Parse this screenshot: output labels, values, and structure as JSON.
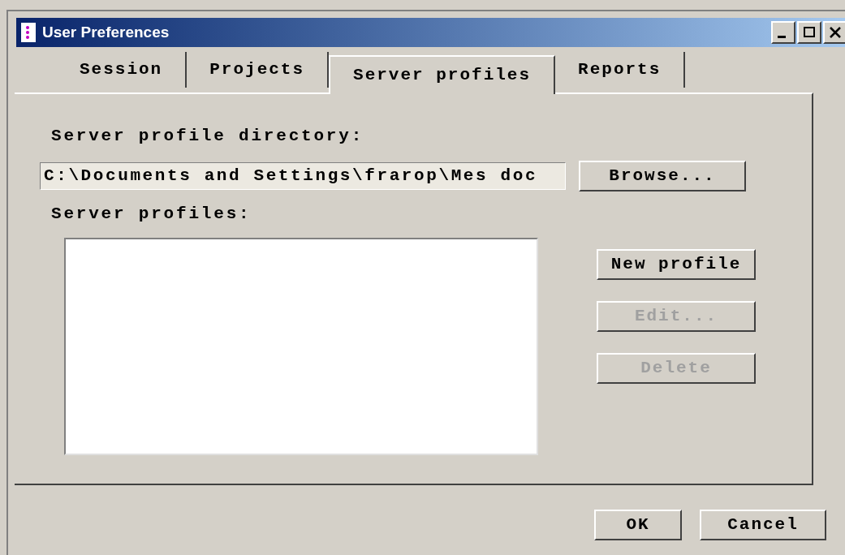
{
  "window": {
    "title": "User Preferences"
  },
  "tabs": [
    {
      "label": "Session",
      "selected": false
    },
    {
      "label": "Projects",
      "selected": false
    },
    {
      "label": "Server profiles",
      "selected": true
    },
    {
      "label": "Reports",
      "selected": false
    }
  ],
  "directory": {
    "label": "Server profile directory:",
    "value": "C:\\Documents and Settings\\frarop\\Mes doc",
    "browse": "Browse..."
  },
  "profiles": {
    "label": "Server profiles:",
    "buttons": [
      {
        "label": "New profile",
        "disabled": false
      },
      {
        "label": "Edit...",
        "disabled": true
      },
      {
        "label": "Delete",
        "disabled": true
      }
    ]
  },
  "footer_buttons": [
    "OK",
    "Cancel"
  ]
}
